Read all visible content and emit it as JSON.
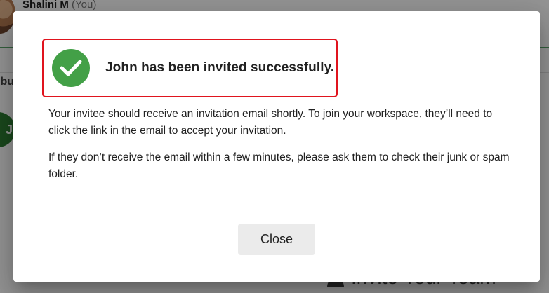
{
  "background": {
    "user_name": "Shalini M",
    "user_tag": "(You)",
    "section_fragment": "ibu",
    "avatar_initial": "J",
    "invite_label": "Invite Your Team"
  },
  "dialog": {
    "title": "John has been invited successfully.",
    "message_1": "Your invitee should receive an invitation email shortly. To join your workspace, they’ll need to click the link in the email to accept your invitation.",
    "message_2": "If they don’t receive the email within a few minutes, please ask them to check their junk or spam folder.",
    "close_label": "Close"
  },
  "colors": {
    "success_green": "#43a047",
    "highlight_border": "#e0141e",
    "close_button_bg": "#ebebeb",
    "overlay": "rgba(0,0,0,0.42)"
  },
  "icons": {
    "success": "check-circle-icon",
    "invite": "person-add-icon"
  }
}
